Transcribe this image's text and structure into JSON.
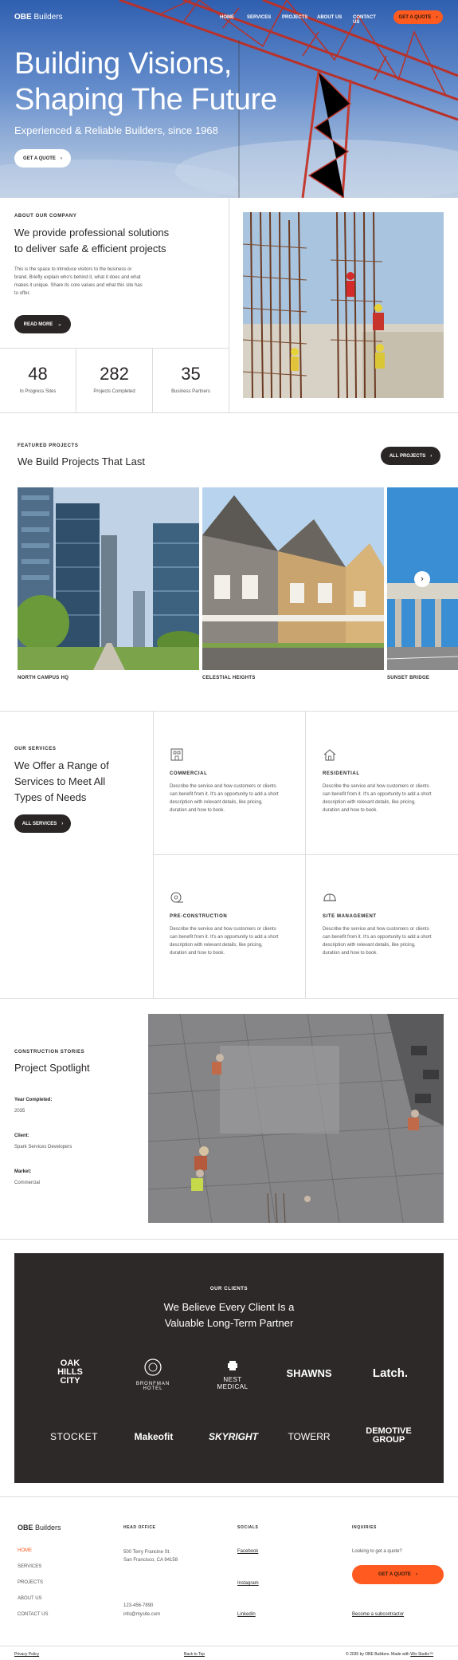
{
  "nav": {
    "logo_bold": "OBE",
    "logo_rest": " Builders",
    "links": [
      "HOME",
      "SERVICES",
      "PROJECTS",
      "ABOUT US",
      "CONTACT US"
    ],
    "cta": "GET A QUOTE"
  },
  "hero": {
    "title_line1": "Building Visions,",
    "title_line2": "Shaping The Future",
    "subtitle": "Experienced & Reliable Builders, since 1968",
    "button": "GET A QUOTE"
  },
  "about": {
    "eyebrow": "ABOUT OUR COMPANY",
    "heading_line1": "We provide professional solutions",
    "heading_line2": "to deliver safe & efficient projects",
    "body": [
      "This is the space to introduce visitors to the business or",
      "brand. Briefly explain who's behind it, what it does and what",
      "makes it unique. Share its core values and what this site has",
      "to offer."
    ],
    "button": "READ MORE"
  },
  "stats": [
    {
      "value": "48",
      "label": "In Progress Sites"
    },
    {
      "value": "282",
      "label": "Projects Completed"
    },
    {
      "value": "35",
      "label": "Business Partners"
    }
  ],
  "projects": {
    "eyebrow": "FEATURED PROJECTS",
    "heading": "We Build Projects That Last",
    "button": "ALL PROJECTS",
    "items": [
      "NORTH CAMPUS HQ",
      "CELESTIAL HEIGHTS",
      "SUNSET BRIDGE"
    ]
  },
  "services": {
    "eyebrow": "OUR SERVICES",
    "heading_line1": "We Offer a Range of",
    "heading_line2": "Services to Meet All",
    "heading_line3": "Types of Needs",
    "button": "ALL SERVICES",
    "items": [
      {
        "title": "COMMERCIAL",
        "icon": "building-icon"
      },
      {
        "title": "RESIDENTIAL",
        "icon": "house-icon"
      },
      {
        "title": "PRE-CONSTRUCTION",
        "icon": "tape-measure-icon"
      },
      {
        "title": "SITE MANAGEMENT",
        "icon": "hard-hat-icon"
      }
    ],
    "desc_lines": [
      "Describe the service and how customers or clients",
      "can benefit from it. It's an opportunity to add a short",
      "description with relevant details, like pricing,",
      "duration and how to book."
    ]
  },
  "spotlight": {
    "eyebrow": "CONSTRUCTION STORIES",
    "heading": "Project Spotlight",
    "fields": [
      {
        "label": "Year Completed:",
        "value": "2035"
      },
      {
        "label": "Client:",
        "value": "Spark Services Developers"
      },
      {
        "label": "Market:",
        "value": "Commercial"
      }
    ]
  },
  "clients": {
    "eyebrow": "OUR CLIENTS",
    "heading_line1": "We Believe Every Client Is a",
    "heading_line2": "Valuable Long-Term Partner",
    "logos_row1": [
      "OAK HILLS CITY",
      "BRONFMAN HOTEL",
      "NEST MEDICAL",
      "SHAWNS",
      "Latch."
    ],
    "logos_row2": [
      "STOCKET",
      "Makeofit",
      "SKYRIGHT",
      "TOWERR",
      "DEMOTIVE GROUP"
    ]
  },
  "footer": {
    "logo_bold": "OBE",
    "logo_rest": " Builders",
    "nav": [
      "HOME",
      "SERVICES",
      "PROJECTS",
      "ABOUT US",
      "CONTACT US"
    ],
    "head_office_title": "HEAD OFFICE",
    "address_line1": "500 Terry Francine St.",
    "address_line2": "San Francisco, CA 94158",
    "phone": "123-456-7890",
    "email": "info@mysite.com",
    "socials_title": "SOCIALS",
    "socials": [
      "Facebook",
      "Instagram",
      "LinkedIn"
    ],
    "inquiries_title": "INQUIRIES",
    "inquiries_text": "Looking to get a quote?",
    "cta": "GET A QUOTE",
    "subcontractor": "Become a subcontractor",
    "privacy": "Privacy Policy",
    "back_to_top": "Back to Top",
    "copyright": "© 2035 by OBE Builders. Made with",
    "wix": "Wix Studio™"
  },
  "colors": {
    "accent": "#ff5a1f",
    "dark": "#2e2929"
  }
}
